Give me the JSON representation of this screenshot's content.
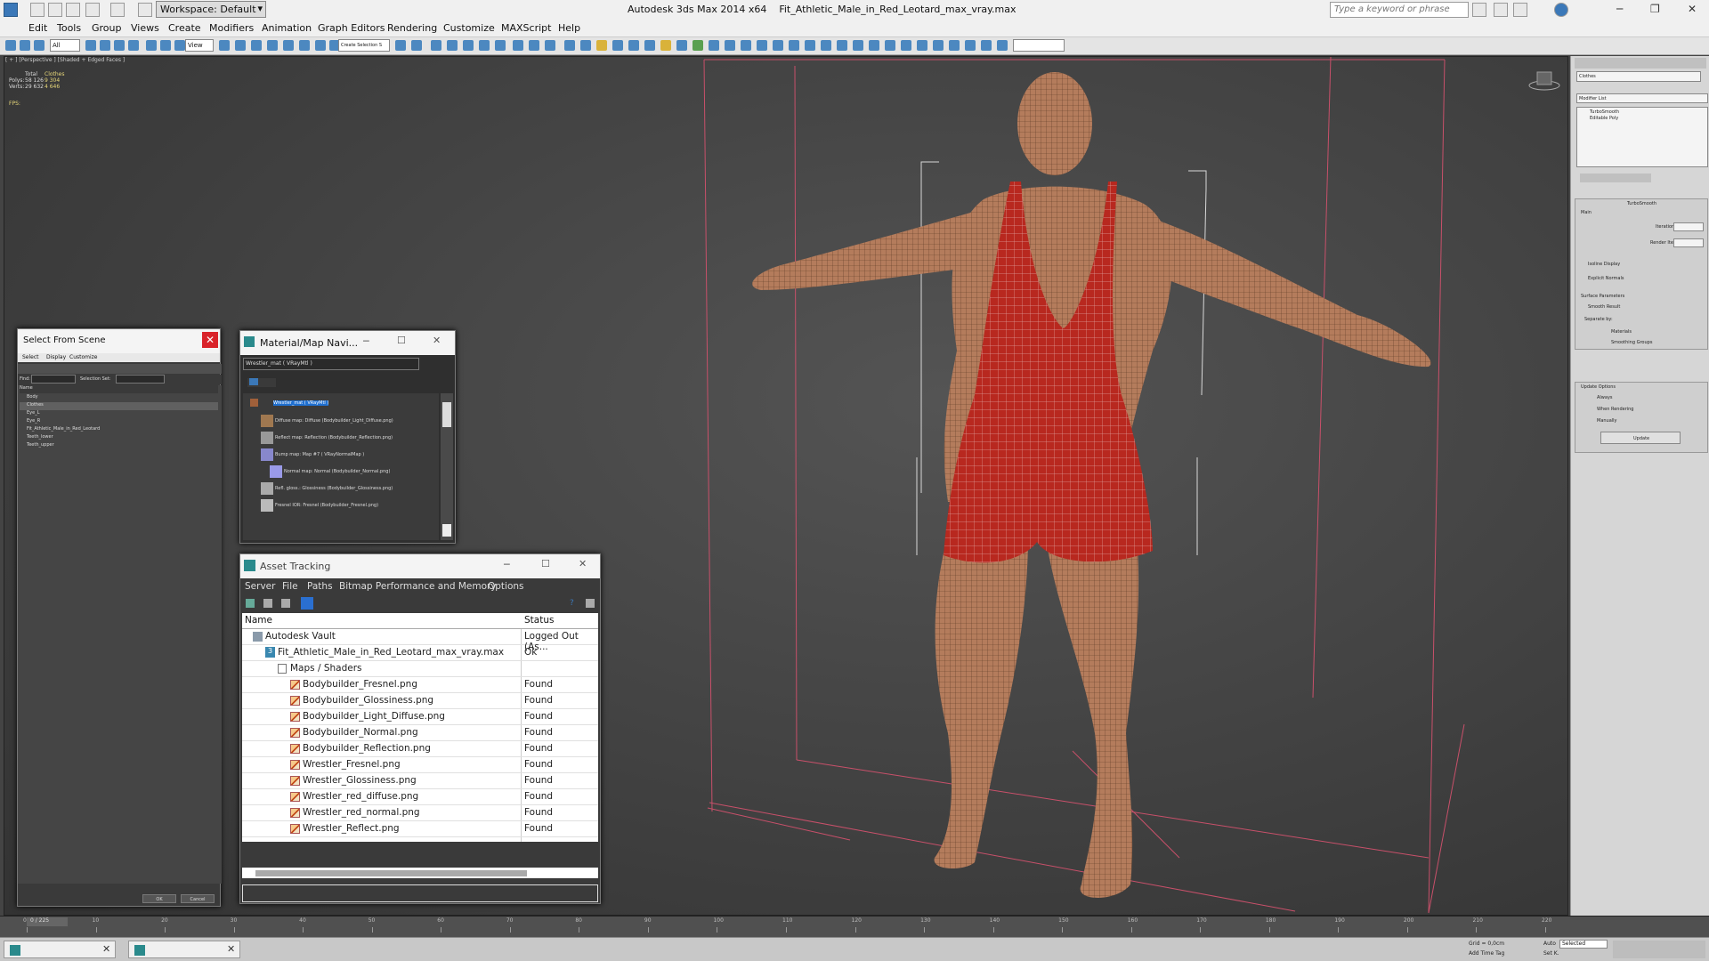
{
  "titlebar": {
    "app": "Autodesk 3ds Max  2014 x64",
    "file": "Fit_Athletic_Male_in_Red_Leotard_max_vray.max",
    "workspace": "Workspace: Default",
    "search_placeholder": "Type a keyword or phrase"
  },
  "menu": [
    "Edit",
    "Tools",
    "Group",
    "Views",
    "Create",
    "Modifiers",
    "Animation",
    "Graph Editors",
    "Rendering",
    "Customize",
    "MAXScript",
    "Help"
  ],
  "viewport": {
    "label": "[ + ] [Perspective ] [Shaded + Edged Faces ]",
    "stats": {
      "head_total": "Total",
      "head_sel": "Clothes",
      "polys_label": "Polys:",
      "polys_total": "58 126",
      "polys_sel": "9 304",
      "verts_label": "Verts:",
      "verts_total": "29 632",
      "verts_sel": "4 646",
      "fps": "FPS:"
    }
  },
  "toolbar": {
    "filter": "All",
    "view": "View",
    "selection_set": "Create Selection S"
  },
  "command_panel": {
    "object_name": "Clothes",
    "modifier_list": "Modifier List",
    "stack": [
      "TurboSmooth",
      "Editable Poly"
    ],
    "rollout": "TurboSmooth",
    "main": "Main",
    "iterations": "Iterations:",
    "render_iters": "Render Iters:",
    "isoline": "Isoline Display",
    "explicit": "Explicit Normals",
    "surface": "Surface Parameters",
    "smooth_result": "Smooth Result",
    "separate": "Separate by:",
    "materials": "Materials",
    "smoothing": "Smoothing Groups",
    "update_opts": "Update Options",
    "always": "Always",
    "when_rendering": "When Rendering",
    "manually": "Manually",
    "update_btn": "Update"
  },
  "select_from_scene": {
    "title": "Select From Scene",
    "menu": [
      "Select",
      "Display",
      "Customize"
    ],
    "find": "Find:",
    "selection_set": "Selection Set:",
    "col_name": "Name",
    "items": [
      "Body",
      "Clothes",
      "Eye_L",
      "Eye_R",
      "Fit_Athletic_Male_in_Red_Leotard",
      "Teeth_lower",
      "Teeth_upper"
    ],
    "ok": "OK",
    "cancel": "Cancel"
  },
  "material_navigator": {
    "title": "Material/Map Navi...",
    "field": "Wrestler_mat  ( VRayMtl )",
    "tree": [
      "Wrestler_mat  ( VRayMtl )",
      "Diffuse map: Diffuse (Bodybuilder_Light_Diffuse.png)",
      "Reflect map: Reflection (Bodybuilder_Reflection.png)",
      "Bump map: Map #7  ( VRayNormalMap )",
      "Normal map: Normal (Bodybuilder_Normal.png)",
      "Refl. gloss.: Glossiness (Bodybuilder_Glossiness.png)",
      "Fresnel IOR: Fresnel (Bodybuilder_Fresnel.png)"
    ]
  },
  "asset_tracking": {
    "title": "Asset Tracking",
    "menu": [
      "Server",
      "File",
      "Paths",
      "Bitmap Performance and Memory",
      "Options"
    ],
    "col_name": "Name",
    "col_status": "Status",
    "rows": [
      {
        "name": "Autodesk Vault",
        "status": "Logged Out (As..."
      },
      {
        "name": "Fit_Athletic_Male_in_Red_Leotard_max_vray.max",
        "status": "Ok"
      },
      {
        "name": "Maps / Shaders",
        "status": ""
      },
      {
        "name": "Bodybuilder_Fresnel.png",
        "status": "Found"
      },
      {
        "name": "Bodybuilder_Glossiness.png",
        "status": "Found"
      },
      {
        "name": "Bodybuilder_Light_Diffuse.png",
        "status": "Found"
      },
      {
        "name": "Bodybuilder_Normal.png",
        "status": "Found"
      },
      {
        "name": "Bodybuilder_Reflection.png",
        "status": "Found"
      },
      {
        "name": "Wrestler_Fresnel.png",
        "status": "Found"
      },
      {
        "name": "Wrestler_Glossiness.png",
        "status": "Found"
      },
      {
        "name": "Wrestler_red_diffuse.png",
        "status": "Found"
      },
      {
        "name": "Wrestler_red_normal.png",
        "status": "Found"
      },
      {
        "name": "Wrestler_Reflect.png",
        "status": "Found"
      }
    ]
  },
  "timeline": {
    "frame": "0 / 225",
    "ticks": [
      "0",
      "10",
      "20",
      "30",
      "40",
      "50",
      "60",
      "70",
      "80",
      "90",
      "100",
      "110",
      "120",
      "130",
      "140",
      "150",
      "160",
      "170",
      "180",
      "190",
      "200",
      "210",
      "220"
    ]
  },
  "statusbar": {
    "grid": "Grid = 0,0cm",
    "add_time_tag": "Add Time Tag",
    "auto": "Auto",
    "selected": "Selected",
    "set_k": "Set K."
  }
}
